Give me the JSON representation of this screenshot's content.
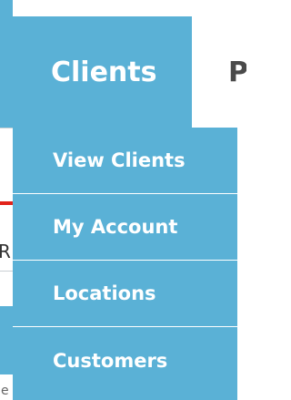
{
  "nav": {
    "tabs": [
      {
        "label": "Clients",
        "active": true
      },
      {
        "label": "P",
        "active": false
      }
    ]
  },
  "dropdown": {
    "items": [
      {
        "label": "View Clients"
      },
      {
        "label": "My Account"
      },
      {
        "label": "Locations"
      },
      {
        "label": "Customers"
      }
    ]
  },
  "background": {
    "fragment_left": "R",
    "fragment_bottom": "e"
  },
  "colors": {
    "menu_blue": "#5ab1d6",
    "accent_red": "#e2231a",
    "text_white": "#ffffff"
  }
}
